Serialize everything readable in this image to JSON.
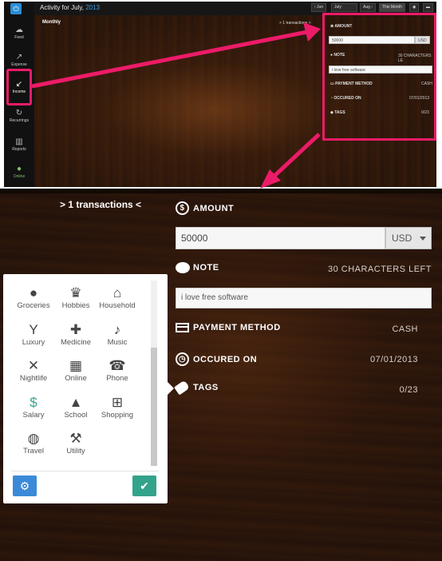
{
  "top": {
    "title": "Activity for July,",
    "title_year": "2013",
    "monthly": "Monthly",
    "controls": {
      "prev_month": "‹ Jun",
      "month_select": "July",
      "next_month": "Aug ›",
      "this_month": "This Month"
    },
    "sidebar": [
      {
        "label": "Feed",
        "icon": "feed-icon"
      },
      {
        "label": "Expense",
        "icon": "arrow-up-right-icon"
      },
      {
        "label": "Income",
        "icon": "arrow-down-left-icon"
      },
      {
        "label": "Recurrings",
        "icon": "refresh-icon"
      },
      {
        "label": "Reports",
        "icon": "bar-chart-icon"
      },
      {
        "label": "Online",
        "icon": "online-icon"
      }
    ],
    "mini_form": {
      "transactions": "> 1 transactions <",
      "amount_label": "AMOUNT",
      "amount_value": "50000",
      "currency": "USD",
      "note_label": "NOTE",
      "note_counter": "30 CHARACTERS LE",
      "note_value": "i love free software",
      "payment_label": "PAYMENT METHOD",
      "payment_value": "CASH",
      "date_label": "OCCURED ON",
      "date_value": "07/01/2013",
      "tags_label": "TAGS",
      "tags_value": "0/23"
    }
  },
  "form": {
    "transactions": "> 1 transactions <",
    "amount_label": "AMOUNT",
    "amount_value": "50000",
    "currency": "USD",
    "note_label": "NOTE",
    "note_counter": "30 CHARACTERS LEFT",
    "note_value": "i love free software",
    "payment_label": "PAYMENT METHOD",
    "payment_value": "CASH",
    "date_label": "OCCURED ON",
    "date_value": "07/01/2013",
    "tags_label": "TAGS",
    "tags_value": "0/23"
  },
  "categories": [
    {
      "label": "Groceries",
      "icon": "apple-icon"
    },
    {
      "label": "Hobbies",
      "icon": "trophy-icon"
    },
    {
      "label": "Household",
      "icon": "house-icon"
    },
    {
      "label": "Luxury",
      "icon": "cocktail-icon"
    },
    {
      "label": "Medicine",
      "icon": "medkit-icon"
    },
    {
      "label": "Music",
      "icon": "music-note-icon"
    },
    {
      "label": "Nightlife",
      "icon": "crossed-swords-icon"
    },
    {
      "label": "Online",
      "icon": "qr-code-icon"
    },
    {
      "label": "Phone",
      "icon": "phone-icon"
    },
    {
      "label": "Salary",
      "icon": "dollar-circle-icon"
    },
    {
      "label": "School",
      "icon": "graduation-cap-icon"
    },
    {
      "label": "Shopping",
      "icon": "cart-icon"
    },
    {
      "label": "Travel",
      "icon": "globe-icon"
    },
    {
      "label": "Utility",
      "icon": "hammer-icon"
    }
  ],
  "colors": {
    "highlight": "#ec1b68",
    "accent_blue": "#3b8ad8",
    "accent_teal": "#34a38b"
  }
}
